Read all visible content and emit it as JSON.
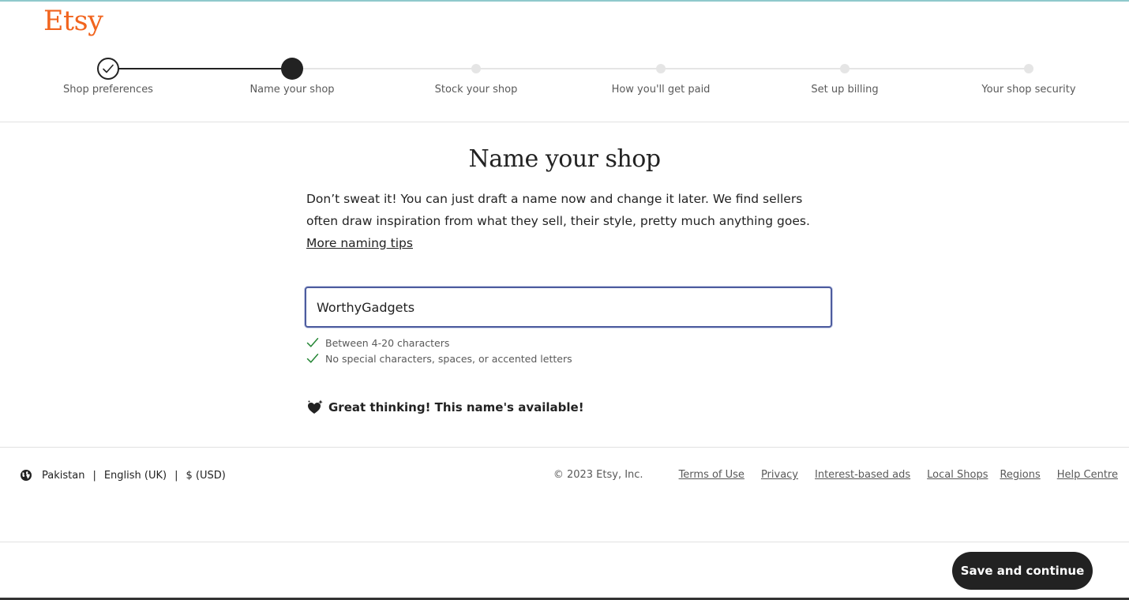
{
  "brand": {
    "logo_text": "Etsy",
    "logo_color": "#f1641e"
  },
  "stepper": {
    "steps": [
      {
        "label": "Shop preferences",
        "state": "completed"
      },
      {
        "label": "Name your shop",
        "state": "current"
      },
      {
        "label": "Stock your shop",
        "state": "pending"
      },
      {
        "label": "How you'll get paid",
        "state": "pending"
      },
      {
        "label": "Set up billing",
        "state": "pending"
      },
      {
        "label": "Your shop security",
        "state": "pending"
      }
    ]
  },
  "main": {
    "title": "Name your shop",
    "description": "Don’t sweat it! You can just draft a name now and change it later. We find sellers often draw inspiration from what they sell, their style, pretty much anything goes.",
    "tips_link": "More naming tips",
    "shop_name_value": "WorthyGadgets",
    "rules": [
      "Between 4-20 characters",
      "No special characters, spaces, or accented letters"
    ],
    "availability_message": "Great thinking! This name's available!"
  },
  "footer": {
    "region": "Pakistan",
    "language": "English (UK)",
    "currency": "$ (USD)",
    "separator": "|",
    "copyright": "© 2023 Etsy, Inc.",
    "links": {
      "terms": "Terms of Use",
      "privacy": "Privacy",
      "interest_ads": "Interest-based ads",
      "local_shops": "Local Shops",
      "regions": "Regions",
      "help": "Help Centre"
    }
  },
  "actions": {
    "save_label": "Save and continue"
  },
  "colors": {
    "accent_check": "#258635",
    "input_border_focus": "#4d5c9e",
    "primary_button": "#222222"
  },
  "icons": {
    "completed_step": "check-icon",
    "rule_ok": "check-icon",
    "availability": "heart-sparkle-icon",
    "locale": "globe-icon"
  }
}
